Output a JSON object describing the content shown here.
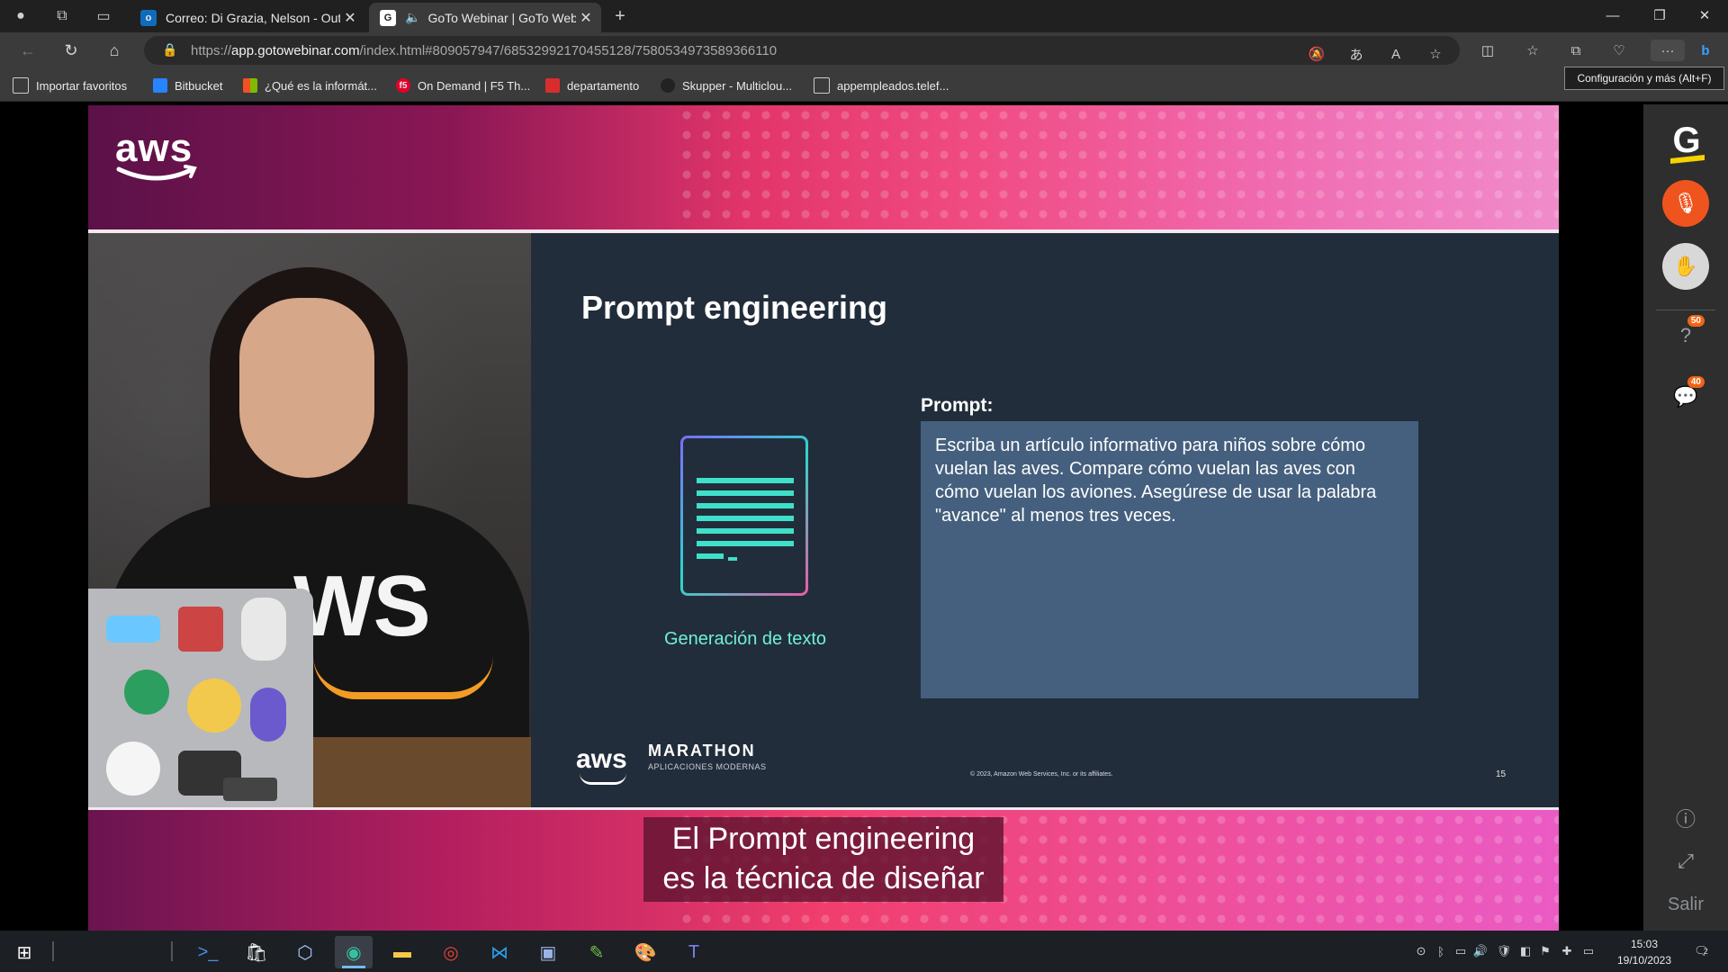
{
  "browser": {
    "tabs": [
      {
        "title": "Correo: Di Grazia, Nelson - Outlo",
        "icon": "outlook-icon",
        "active": false
      },
      {
        "title": "GoTo Webinar | GoTo Webin",
        "icon": "goto-icon",
        "active": true
      }
    ],
    "url": {
      "host": "app.gotowebinar.com",
      "prefix": "https://",
      "path": "/index.html#809057947/6853299217045512​8/7580534973589366110"
    },
    "tooltip": "Configuración y más (Alt+F)"
  },
  "favorites": [
    {
      "label": "Importar favoritos",
      "icon": "import-icon"
    },
    {
      "label": "Bitbucket",
      "icon": "bitbucket-icon"
    },
    {
      "label": "¿Qué es la informát...",
      "icon": "microsoft-icon"
    },
    {
      "label": "On Demand | F5 Th...",
      "icon": "f5-icon"
    },
    {
      "label": "departamento",
      "icon": "pdf-icon"
    },
    {
      "label": "Skupper - Multiclou...",
      "icon": "skupper-icon"
    },
    {
      "label": "appempleados.telef...",
      "icon": "page-icon"
    }
  ],
  "webinar": {
    "brand": "aws",
    "slide": {
      "title": "Prompt engineering",
      "doc_label": "Generación de texto",
      "prompt_label": "Prompt:",
      "prompt_text": "Escriba un artículo informativo para niños sobre cómo vuelan las aves. Compare cómo vuelan las aves con cómo vuelan los aviones. Asegúrese de usar la palabra \"avance\" al menos tres veces.",
      "footer_brand": "aws",
      "footer_title": "MARATHON",
      "footer_sub": "APLICACIONES MODERNAS",
      "copyright": "© 2023, Amazon Web Services, Inc. or its affiliates.",
      "page_number": "15"
    },
    "video": {
      "shirt_text": "WS"
    },
    "caption_line1": "El Prompt engineering",
    "caption_line2": "es la técnica de diseñar"
  },
  "rail": {
    "logo": "G",
    "questions_badge": "50",
    "chat_badge": "40",
    "exit_label": "Salir"
  },
  "taskbar": {
    "time": "15:03",
    "date": "19/10/2023",
    "notifications": "2"
  }
}
